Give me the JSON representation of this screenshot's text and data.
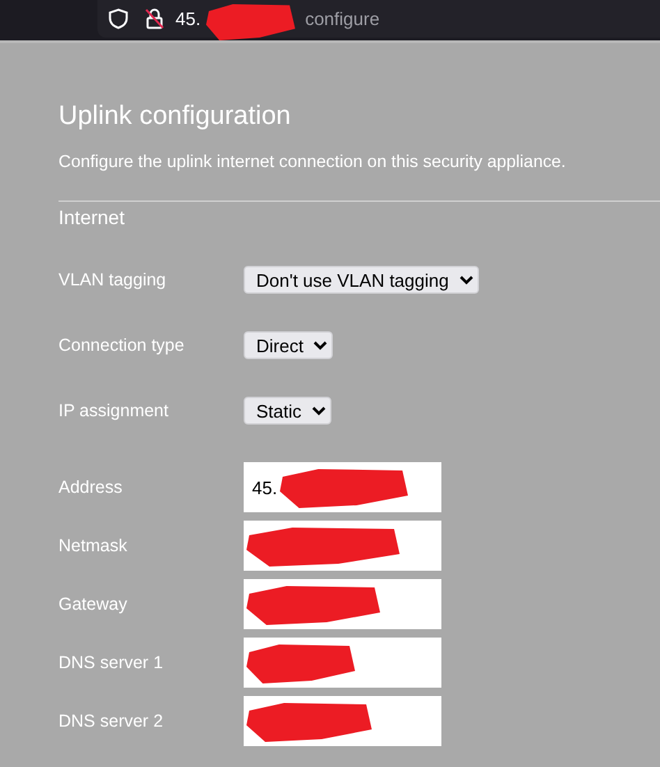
{
  "address_bar": {
    "text_start": "45.",
    "text_end": "configure",
    "redacted": true
  },
  "page": {
    "title": "Uplink configuration",
    "description": "Configure the uplink internet connection on this security appliance."
  },
  "section": {
    "title": "Internet"
  },
  "settings": [
    {
      "label": "VLAN tagging",
      "kind": "select",
      "value": "Don't use VLAN tagging"
    },
    {
      "label": "Connection type",
      "kind": "select",
      "value": "Direct"
    },
    {
      "label": "IP assignment",
      "kind": "select",
      "value": "Static"
    },
    {
      "label": "Address",
      "kind": "text",
      "value": "45.",
      "redacted": true
    },
    {
      "label": "Netmask",
      "kind": "text",
      "redacted": true
    },
    {
      "label": "Gateway",
      "kind": "text",
      "redacted": true
    },
    {
      "label": "DNS server 1",
      "kind": "text",
      "redacted": true
    },
    {
      "label": "DNS server 2",
      "kind": "text",
      "redacted": true
    }
  ]
}
